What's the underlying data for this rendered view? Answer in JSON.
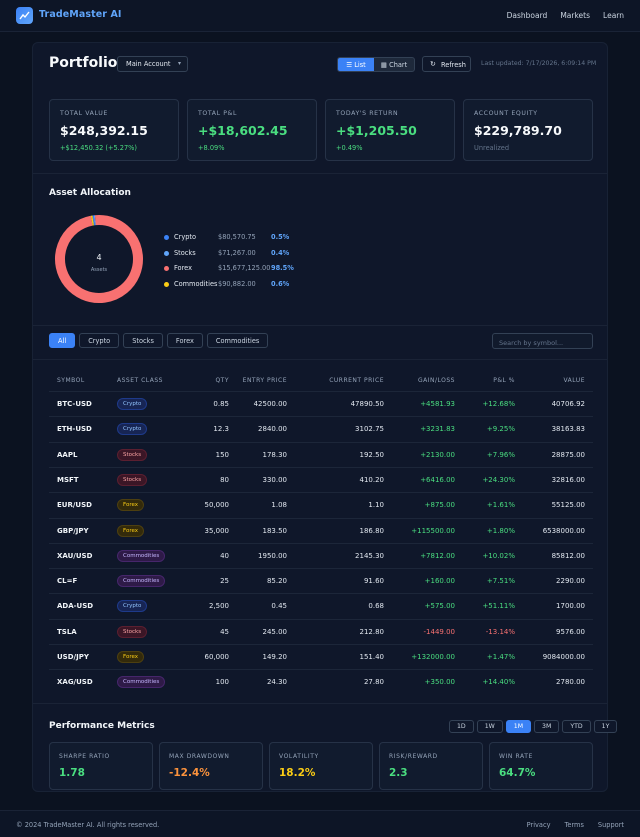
{
  "nav": {
    "brand": "TradeMaster AI",
    "links": [
      "Dashboard",
      "Markets",
      "Learn"
    ]
  },
  "header": {
    "title": "Portfolio",
    "account": "Main Account",
    "view_list": "List",
    "view_chart": "Chart",
    "refresh": "Refresh",
    "updated": "Last updated: 7/17/2026, 6:09:14 PM"
  },
  "stats": [
    {
      "label": "TOTAL VALUE",
      "value": "$248,392.15",
      "sub": "+$12,450.32 (+5.27%)"
    },
    {
      "label": "TOTAL P&L",
      "value": "+$18,602.45",
      "sub": "+8.09%"
    },
    {
      "label": "TODAY'S RETURN",
      "value": "+$1,205.50",
      "sub": "+0.49%"
    },
    {
      "label": "ACCOUNT EQUITY",
      "value": "$229,789.70",
      "sub": "Unrealized"
    }
  ],
  "allocation": {
    "title": "Asset Allocation",
    "center_count": "4",
    "center_label": "Assets",
    "items": [
      {
        "name": "Crypto",
        "amount": "$80,570.75",
        "pct": "0.5%",
        "share": 0.5,
        "color": "#3b82f6"
      },
      {
        "name": "Stocks",
        "amount": "$71,267.00",
        "pct": "0.4%",
        "share": 0.4,
        "color": "#60a5fa"
      },
      {
        "name": "Forex",
        "amount": "$15,677,125.00",
        "pct": "98.5%",
        "share": 98.5,
        "color": "#f87171"
      },
      {
        "name": "Commodities",
        "amount": "$90,882.00",
        "pct": "0.6%",
        "share": 0.6,
        "color": "#facc15"
      }
    ]
  },
  "filters": [
    "All",
    "Crypto",
    "Stocks",
    "Forex",
    "Commodities"
  ],
  "search_placeholder": "Search by symbol...",
  "table": {
    "headers": [
      "SYMBOL",
      "ASSET CLASS",
      "QTY",
      "ENTRY PRICE",
      "CURRENT PRICE",
      "GAIN/LOSS",
      "P&L %",
      "VALUE"
    ],
    "rows": [
      {
        "symbol": "BTC-USD",
        "cls": "Crypto",
        "qty": "0.85",
        "entry": "42500.00",
        "current": "47890.50",
        "gl": "+4581.93",
        "pl": "+12.68%",
        "value": "40706.92"
      },
      {
        "symbol": "ETH-USD",
        "cls": "Crypto",
        "qty": "12.3",
        "entry": "2840.00",
        "current": "3102.75",
        "gl": "+3231.83",
        "pl": "+9.25%",
        "value": "38163.83"
      },
      {
        "symbol": "AAPL",
        "cls": "Stocks",
        "qty": "150",
        "entry": "178.30",
        "current": "192.50",
        "gl": "+2130.00",
        "pl": "+7.96%",
        "value": "28875.00"
      },
      {
        "symbol": "MSFT",
        "cls": "Stocks",
        "qty": "80",
        "entry": "330.00",
        "current": "410.20",
        "gl": "+6416.00",
        "pl": "+24.30%",
        "value": "32816.00"
      },
      {
        "symbol": "EUR/USD",
        "cls": "Forex",
        "qty": "50,000",
        "entry": "1.08",
        "current": "1.10",
        "gl": "+875.00",
        "pl": "+1.61%",
        "value": "55125.00"
      },
      {
        "symbol": "GBP/JPY",
        "cls": "Forex",
        "qty": "35,000",
        "entry": "183.50",
        "current": "186.80",
        "gl": "+115500.00",
        "pl": "+1.80%",
        "value": "6538000.00"
      },
      {
        "symbol": "XAU/USD",
        "cls": "Commodities",
        "qty": "40",
        "entry": "1950.00",
        "current": "2145.30",
        "gl": "+7812.00",
        "pl": "+10.02%",
        "value": "85812.00"
      },
      {
        "symbol": "CL=F",
        "cls": "Commodities",
        "qty": "25",
        "entry": "85.20",
        "current": "91.60",
        "gl": "+160.00",
        "pl": "+7.51%",
        "value": "2290.00"
      },
      {
        "symbol": "ADA-USD",
        "cls": "Crypto",
        "qty": "2,500",
        "entry": "0.45",
        "current": "0.68",
        "gl": "+575.00",
        "pl": "+51.11%",
        "value": "1700.00"
      },
      {
        "symbol": "TSLA",
        "cls": "Stocks",
        "qty": "45",
        "entry": "245.00",
        "current": "212.80",
        "gl": "-1449.00",
        "pl": "-13.14%",
        "value": "9576.00"
      },
      {
        "symbol": "USD/JPY",
        "cls": "Forex",
        "qty": "60,000",
        "entry": "149.20",
        "current": "151.40",
        "gl": "+132000.00",
        "pl": "+1.47%",
        "value": "9084000.00"
      },
      {
        "symbol": "XAG/USD",
        "cls": "Commodities",
        "qty": "100",
        "entry": "24.30",
        "current": "27.80",
        "gl": "+350.00",
        "pl": "+14.40%",
        "value": "2780.00"
      }
    ]
  },
  "performance": {
    "title": "Performance Metrics",
    "ranges": [
      "1D",
      "1W",
      "1M",
      "3M",
      "YTD",
      "1Y"
    ],
    "active_range": "1M",
    "metrics": [
      {
        "label": "SHARPE RATIO",
        "value": "1.78",
        "color": "#4ade80"
      },
      {
        "label": "MAX DRAWDOWN",
        "value": "-12.4%",
        "color": "#fb923c"
      },
      {
        "label": "VOLATILITY",
        "value": "18.2%",
        "color": "#facc15"
      },
      {
        "label": "RISK/REWARD",
        "value": "2.3",
        "color": "#4ade80"
      },
      {
        "label": "WIN RATE",
        "value": "64.7%",
        "color": "#4ade80"
      }
    ]
  },
  "footer": {
    "copyright": "© 2024 TradeMaster AI. All rights reserved.",
    "links": [
      "Privacy",
      "Terms",
      "Support"
    ]
  }
}
